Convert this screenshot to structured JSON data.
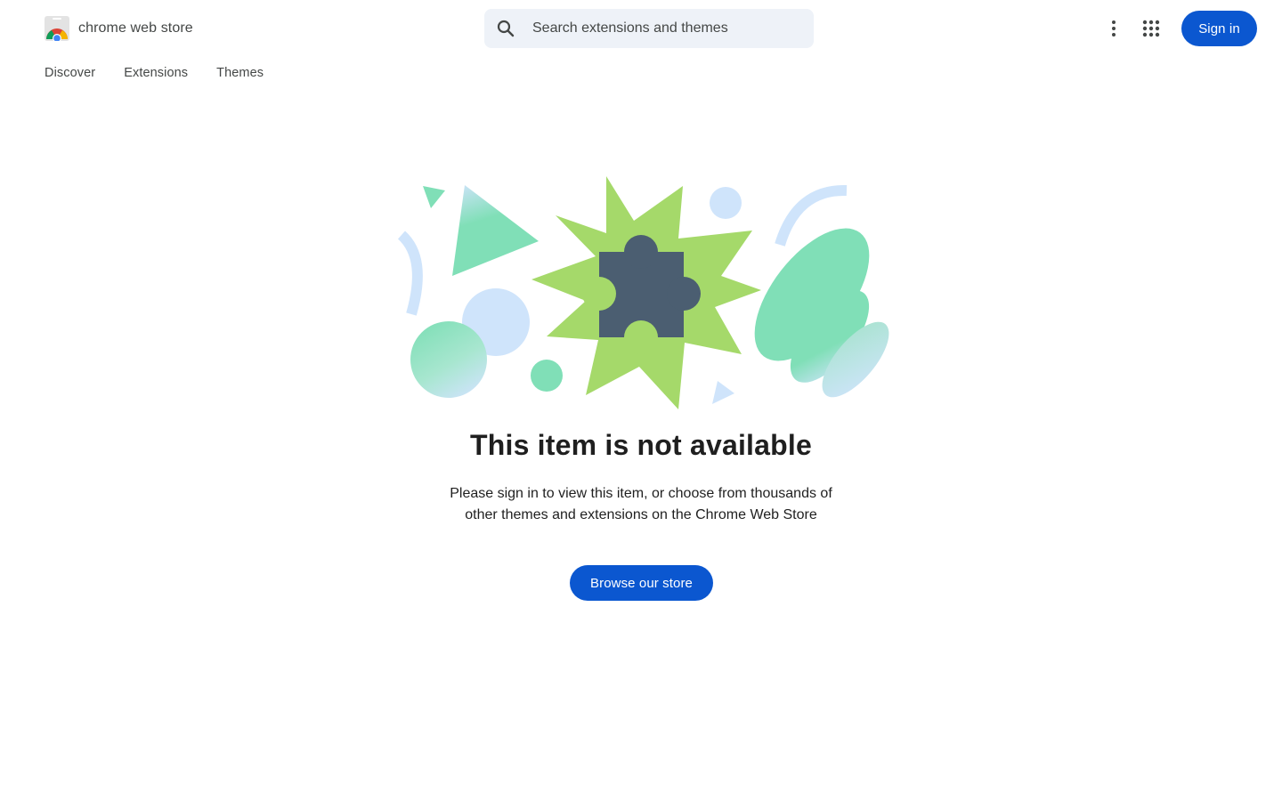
{
  "header": {
    "brand_name": "chrome web store",
    "search_placeholder": "Search extensions and themes",
    "search_value": "",
    "signin_label": "Sign in"
  },
  "nav": {
    "items": [
      {
        "label": "Discover"
      },
      {
        "label": "Extensions"
      },
      {
        "label": "Themes"
      }
    ]
  },
  "main": {
    "title": "This item is not available",
    "description": "Please sign in to view this item, or choose from thousands of other themes and extensions on the Chrome Web Store",
    "browse_label": "Browse our store"
  },
  "colors": {
    "primary_blue": "#0b57d0",
    "search_bg": "#eef2f8",
    "burst_green": "#a5d96a",
    "puzzle_slate": "#4b5e71",
    "mint": "#80dfb7",
    "light_blue": "#cfe4fb"
  },
  "icons": {
    "logo": "chrome-web-store-logo",
    "search": "search-icon",
    "more": "more-vert-icon",
    "apps": "apps-grid-icon",
    "puzzle": "puzzle-piece-icon"
  }
}
